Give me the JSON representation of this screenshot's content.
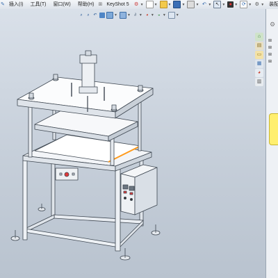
{
  "menubar": {
    "items": [
      {
        "label": "插入(I)"
      },
      {
        "label": "工具(T)"
      },
      {
        "label": "窗口(W)"
      },
      {
        "label": "帮助(H)"
      },
      {
        "label": "KeyShot 5"
      },
      {
        "label": "装配..."
      }
    ]
  },
  "icons": {
    "menu_toolbar": [
      "sketch-icon",
      "new-document-icon",
      "open-icon",
      "save-icon",
      "print-icon",
      "undo-icon",
      "redo-icon",
      "select-icon",
      "traffic-light-icon",
      "rebuild-icon",
      "options-icon"
    ],
    "heads_up": [
      "zoom-to-fit-icon",
      "zoom-area-icon",
      "previous-view-icon",
      "section-view-icon",
      "view-orientation-icon",
      "display-style-icon",
      "hide-show-icon",
      "edit-appearance-icon",
      "apply-scene-icon",
      "view-settings-icon"
    ],
    "task_pane": [
      "solidworks-resources-icon",
      "design-library-icon",
      "file-explorer-icon",
      "view-palette-icon",
      "appearances-icon",
      "custom-properties-icon"
    ]
  },
  "colors": {
    "frame_steel": "#e9edf2",
    "plate": "#ffffff",
    "highlight_edge": "#ff9a1a",
    "control_box": "#eef1f4"
  }
}
